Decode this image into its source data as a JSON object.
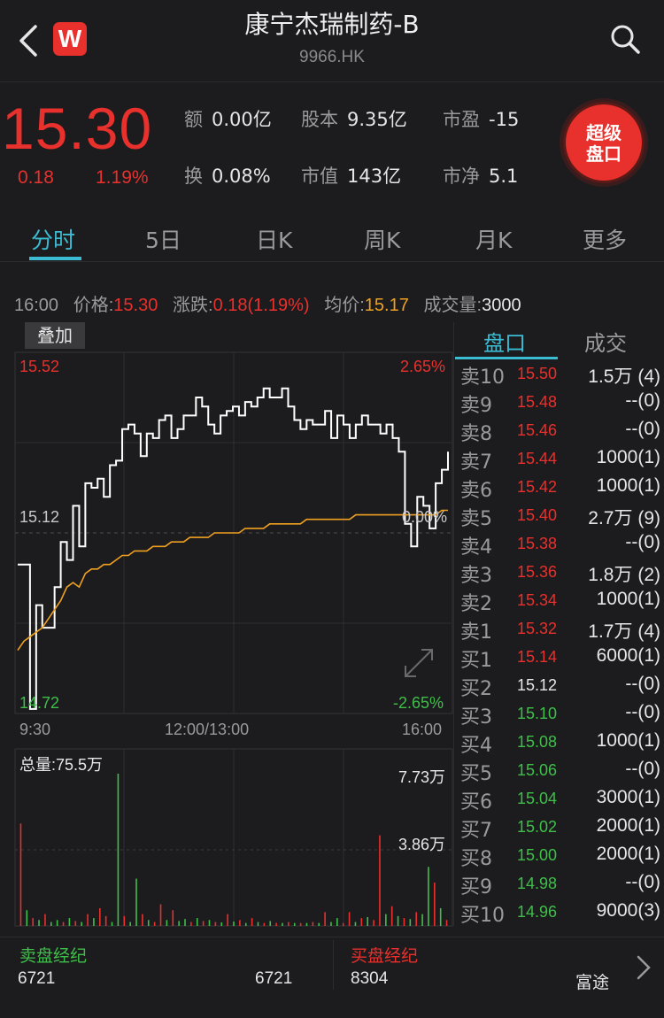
{
  "header": {
    "title": "康宁杰瑞制药-B",
    "code": "9966.HK",
    "logo_letter": "W"
  },
  "quote": {
    "price": "15.30",
    "change": "0.18",
    "change_pct": "1.19%",
    "stats": [
      {
        "key": "额",
        "value": "0.00亿"
      },
      {
        "key": "股本",
        "value": "9.35亿"
      },
      {
        "key": "市盈",
        "value": "-15"
      },
      {
        "key": "换",
        "value": "0.08%"
      },
      {
        "key": "市值",
        "value": "143亿"
      },
      {
        "key": "市净",
        "value": "5.1"
      }
    ],
    "super_button": {
      "line1": "超级",
      "line2": "盘口"
    }
  },
  "tabs": [
    "分时",
    "5日",
    "日K",
    "周K",
    "月K",
    "更多"
  ],
  "info": {
    "time": "16:00",
    "price_label": "价格:",
    "price": "15.30",
    "change_label": "涨跌:",
    "change": "0.18(1.19%)",
    "avg_label": "均价:",
    "avg": "15.17",
    "volume_label": "成交量:",
    "volume": "3000"
  },
  "chart_data": {
    "type": "line",
    "overlay_button": "叠加",
    "y_labels": {
      "top": "15.52",
      "mid": "15.12",
      "bottom": "14.72"
    },
    "pct_labels": {
      "top": "2.65%",
      "mid": "0.00%",
      "bottom": "-2.65%"
    },
    "x_labels": [
      "9:30",
      "12:00/13:00",
      "16:00"
    ],
    "ylim": [
      14.72,
      15.52
    ],
    "prev_close": 15.12,
    "price_series": [
      15.05,
      15.05,
      14.73,
      14.96,
      14.91,
      14.91,
      15.0,
      15.1,
      15.06,
      15.18,
      15.09,
      15.23,
      15.22,
      15.24,
      15.2,
      15.27,
      15.28,
      15.35,
      15.36,
      15.34,
      15.29,
      15.34,
      15.33,
      15.37,
      15.38,
      15.33,
      15.35,
      15.38,
      15.38,
      15.42,
      15.4,
      15.36,
      15.34,
      15.38,
      15.39,
      15.4,
      15.38,
      15.41,
      15.4,
      15.42,
      15.44,
      15.42,
      15.42,
      15.44,
      15.4,
      15.37,
      15.35,
      15.37,
      15.36,
      15.36,
      15.39,
      15.33,
      15.38,
      15.36,
      15.33,
      15.36,
      15.38,
      15.36,
      15.36,
      15.34,
      15.36,
      15.33,
      15.3,
      15.14,
      15.09,
      15.2,
      15.18,
      15.13,
      15.23,
      15.26,
      15.3
    ],
    "avg_series": [
      14.86,
      14.88,
      14.89,
      14.9,
      14.91,
      14.93,
      14.95,
      14.97,
      15.0,
      15.01,
      15.0,
      15.03,
      15.04,
      15.04,
      15.05,
      15.05,
      15.06,
      15.07,
      15.07,
      15.08,
      15.08,
      15.08,
      15.09,
      15.09,
      15.09,
      15.1,
      15.1,
      15.1,
      15.11,
      15.11,
      15.11,
      15.11,
      15.12,
      15.12,
      15.12,
      15.12,
      15.12,
      15.13,
      15.13,
      15.13,
      15.13,
      15.14,
      15.14,
      15.14,
      15.14,
      15.14,
      15.14,
      15.15,
      15.15,
      15.15,
      15.15,
      15.15,
      15.15,
      15.15,
      15.15,
      15.16,
      15.16,
      15.16,
      15.16,
      15.16,
      15.16,
      15.16,
      15.16,
      15.16,
      15.16,
      15.16,
      15.16,
      15.16,
      15.16,
      15.17,
      15.17
    ],
    "series": [
      {
        "name": "价格",
        "color": "#ffffff"
      },
      {
        "name": "均价",
        "color": "#f0a020"
      }
    ],
    "volume": {
      "total_label": "总量:75.5万",
      "max_label": "7.73万",
      "mid_label": "3.86万",
      "max": 77300,
      "bars": [
        {
          "v": 52000,
          "d": "up"
        },
        {
          "v": 8000,
          "d": "down"
        },
        {
          "v": 4000,
          "d": "up"
        },
        {
          "v": 3000,
          "d": "down"
        },
        {
          "v": 6000,
          "d": "up"
        },
        {
          "v": 2000,
          "d": "down"
        },
        {
          "v": 3000,
          "d": "down"
        },
        {
          "v": 2000,
          "d": "up"
        },
        {
          "v": 4000,
          "d": "down"
        },
        {
          "v": 2500,
          "d": "up"
        },
        {
          "v": 2000,
          "d": "down"
        },
        {
          "v": 6000,
          "d": "up"
        },
        {
          "v": 4000,
          "d": "down"
        },
        {
          "v": 9000,
          "d": "up"
        },
        {
          "v": 5000,
          "d": "up"
        },
        {
          "v": 2000,
          "d": "down"
        },
        {
          "v": 77300,
          "d": "down"
        },
        {
          "v": 5000,
          "d": "up"
        },
        {
          "v": 2000,
          "d": "down"
        },
        {
          "v": 24000,
          "d": "down"
        },
        {
          "v": 6000,
          "d": "up"
        },
        {
          "v": 3000,
          "d": "down"
        },
        {
          "v": 2000,
          "d": "up"
        },
        {
          "v": 11000,
          "d": "up"
        },
        {
          "v": 3000,
          "d": "down"
        },
        {
          "v": 8000,
          "d": "up"
        },
        {
          "v": 2500,
          "d": "down"
        },
        {
          "v": 3500,
          "d": "down"
        },
        {
          "v": 2000,
          "d": "up"
        },
        {
          "v": 4000,
          "d": "down"
        },
        {
          "v": 2500,
          "d": "up"
        },
        {
          "v": 3000,
          "d": "down"
        },
        {
          "v": 2000,
          "d": "up"
        },
        {
          "v": 1800,
          "d": "down"
        },
        {
          "v": 6000,
          "d": "up"
        },
        {
          "v": 2200,
          "d": "down"
        },
        {
          "v": 3000,
          "d": "up"
        },
        {
          "v": 1500,
          "d": "down"
        },
        {
          "v": 4000,
          "d": "up"
        },
        {
          "v": 2000,
          "d": "down"
        },
        {
          "v": 1500,
          "d": "up"
        },
        {
          "v": 2500,
          "d": "down"
        },
        {
          "v": 1500,
          "d": "up"
        },
        {
          "v": 1500,
          "d": "down"
        },
        {
          "v": 2000,
          "d": "up"
        },
        {
          "v": 1500,
          "d": "down"
        },
        {
          "v": 1500,
          "d": "up"
        },
        {
          "v": 1500,
          "d": "down"
        },
        {
          "v": 2000,
          "d": "up"
        },
        {
          "v": 1500,
          "d": "down"
        },
        {
          "v": 7000,
          "d": "up"
        },
        {
          "v": 2000,
          "d": "down"
        },
        {
          "v": 4000,
          "d": "down"
        },
        {
          "v": 1500,
          "d": "up"
        },
        {
          "v": 7000,
          "d": "up"
        },
        {
          "v": 2000,
          "d": "down"
        },
        {
          "v": 4000,
          "d": "up"
        },
        {
          "v": 4500,
          "d": "down"
        },
        {
          "v": 3000,
          "d": "up"
        },
        {
          "v": 46000,
          "d": "up"
        },
        {
          "v": 6000,
          "d": "down"
        },
        {
          "v": 10000,
          "d": "up"
        },
        {
          "v": 5000,
          "d": "down"
        },
        {
          "v": 4000,
          "d": "up"
        },
        {
          "v": 3500,
          "d": "down"
        },
        {
          "v": 7000,
          "d": "up"
        },
        {
          "v": 6000,
          "d": "down"
        },
        {
          "v": 30000,
          "d": "down"
        },
        {
          "v": 22000,
          "d": "up"
        },
        {
          "v": 9000,
          "d": "down"
        },
        {
          "v": 3000,
          "d": "up"
        }
      ]
    }
  },
  "orderbook": {
    "tabs": [
      "盘口",
      "成交"
    ],
    "rows": [
      {
        "label": "卖10",
        "price": "15.50",
        "vol": "1.5万 (4)",
        "color": "red"
      },
      {
        "label": "卖9",
        "price": "15.48",
        "vol": "--(0)",
        "color": "red"
      },
      {
        "label": "卖8",
        "price": "15.46",
        "vol": "--(0)",
        "color": "red"
      },
      {
        "label": "卖7",
        "price": "15.44",
        "vol": "1000(1)",
        "color": "red"
      },
      {
        "label": "卖6",
        "price": "15.42",
        "vol": "1000(1)",
        "color": "red"
      },
      {
        "label": "卖5",
        "price": "15.40",
        "vol": "2.7万 (9)",
        "color": "red"
      },
      {
        "label": "卖4",
        "price": "15.38",
        "vol": "--(0)",
        "color": "red"
      },
      {
        "label": "卖3",
        "price": "15.36",
        "vol": "1.8万 (2)",
        "color": "red"
      },
      {
        "label": "卖2",
        "price": "15.34",
        "vol": "1000(1)",
        "color": "red"
      },
      {
        "label": "卖1",
        "price": "15.32",
        "vol": "1.7万 (4)",
        "color": "red"
      },
      {
        "label": "买1",
        "price": "15.14",
        "vol": "6000(1)",
        "color": "red"
      },
      {
        "label": "买2",
        "price": "15.12",
        "vol": "--(0)",
        "color": "white"
      },
      {
        "label": "买3",
        "price": "15.10",
        "vol": "--(0)",
        "color": "green"
      },
      {
        "label": "买4",
        "price": "15.08",
        "vol": "1000(1)",
        "color": "green"
      },
      {
        "label": "买5",
        "price": "15.06",
        "vol": "--(0)",
        "color": "green"
      },
      {
        "label": "买6",
        "price": "15.04",
        "vol": "3000(1)",
        "color": "green"
      },
      {
        "label": "买7",
        "price": "15.02",
        "vol": "2000(1)",
        "color": "green"
      },
      {
        "label": "买8",
        "price": "15.00",
        "vol": "2000(1)",
        "color": "green"
      },
      {
        "label": "买9",
        "price": "14.98",
        "vol": "--(0)",
        "color": "green"
      },
      {
        "label": "买10",
        "price": "14.96",
        "vol": "9000(3)",
        "color": "green"
      }
    ]
  },
  "broker": {
    "sell_title": "卖盘经纪",
    "sell_value": "6721",
    "sell_value_right": "6721",
    "buy_title": "买盘经纪",
    "buy_value": "8304",
    "buy_name": "富途"
  },
  "colors": {
    "up": "#e8302c",
    "down": "#3fbf4a",
    "accent": "#3cbcd2",
    "avg": "#f0a020"
  }
}
